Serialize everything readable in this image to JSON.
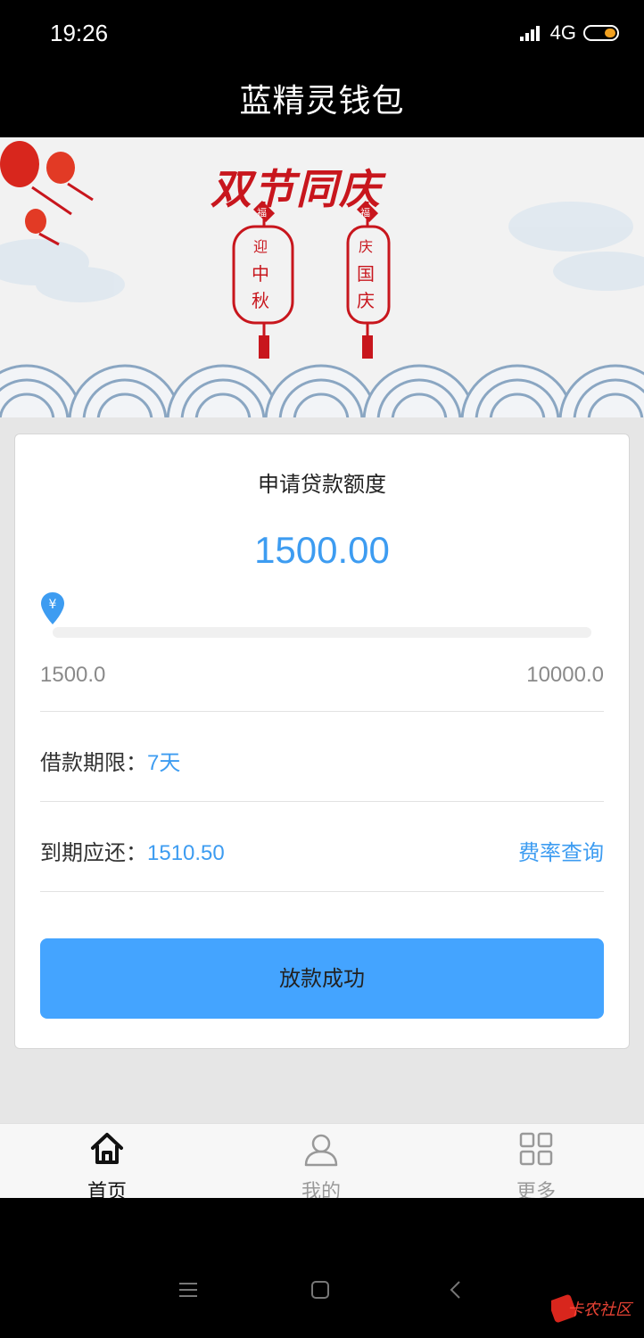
{
  "status_bar": {
    "time": "19:26",
    "network": "4G",
    "colors": {
      "battery_fill": "#f0a020"
    }
  },
  "header": {
    "title": "蓝精灵钱包"
  },
  "banner": {
    "headline": "双节同庆",
    "lantern_left": {
      "top": "福",
      "chars": [
        "迎",
        "中",
        "秋"
      ]
    },
    "lantern_right": {
      "top": "福",
      "chars": [
        "庆",
        "国",
        "庆"
      ]
    }
  },
  "loan_card": {
    "title": "申请贷款额度",
    "amount": "1500.00",
    "slider": {
      "icon": "yuan-marker-icon",
      "min_label": "1500.0",
      "max_label": "10000.0",
      "position": 0
    },
    "term_label": "借款期限：",
    "term_value": "7天",
    "due_label": "到期应还：",
    "due_value": "1510.50",
    "rate_link": "费率查询",
    "submit_label": "放款成功"
  },
  "tab_bar": {
    "items": [
      {
        "label": "首页",
        "icon": "home-icon",
        "active": true
      },
      {
        "label": "我的",
        "icon": "user-icon",
        "active": false
      },
      {
        "label": "更多",
        "icon": "grid-icon",
        "active": false
      }
    ]
  },
  "colors": {
    "accent": "#3d9cf1",
    "button": "#44a4ff",
    "lantern_red": "#c8161d"
  }
}
